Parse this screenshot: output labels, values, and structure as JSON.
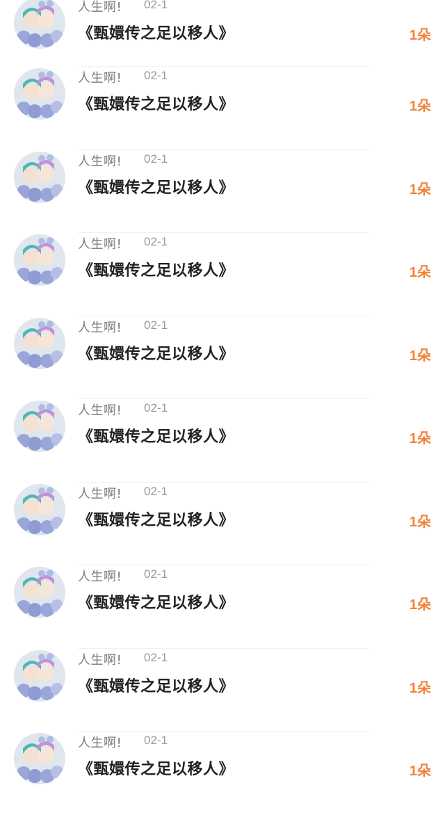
{
  "gift_list": {
    "items": [
      {
        "user_name": "人生啊!",
        "date": "02-1",
        "title": "《甄嬛传之足以移人》",
        "count": "1朵"
      },
      {
        "user_name": "人生啊!",
        "date": "02-1",
        "title": "《甄嬛传之足以移人》",
        "count": "1朵"
      },
      {
        "user_name": "人生啊!",
        "date": "02-1",
        "title": "《甄嬛传之足以移人》",
        "count": "1朵"
      },
      {
        "user_name": "人生啊!",
        "date": "02-1",
        "title": "《甄嬛传之足以移人》",
        "count": "1朵"
      },
      {
        "user_name": "人生啊!",
        "date": "02-1",
        "title": "《甄嬛传之足以移人》",
        "count": "1朵"
      },
      {
        "user_name": "人生啊!",
        "date": "02-1",
        "title": "《甄嬛传之足以移人》",
        "count": "1朵"
      },
      {
        "user_name": "人生啊!",
        "date": "02-1",
        "title": "《甄嬛传之足以移人》",
        "count": "1朵"
      },
      {
        "user_name": "人生啊!",
        "date": "02-1",
        "title": "《甄嬛传之足以移人》",
        "count": "1朵"
      },
      {
        "user_name": "人生啊!",
        "date": "02-1",
        "title": "《甄嬛传之足以移人》",
        "count": "1朵"
      },
      {
        "user_name": "人生啊!",
        "date": "02-1",
        "title": "《甄嬛传之足以移人》",
        "count": "1朵"
      }
    ]
  },
  "colors": {
    "count_accent": "#f0833a",
    "title_text": "#222222",
    "meta_text": "#7a7a7a"
  },
  "icons": {
    "avatar": "user-avatar-image"
  }
}
